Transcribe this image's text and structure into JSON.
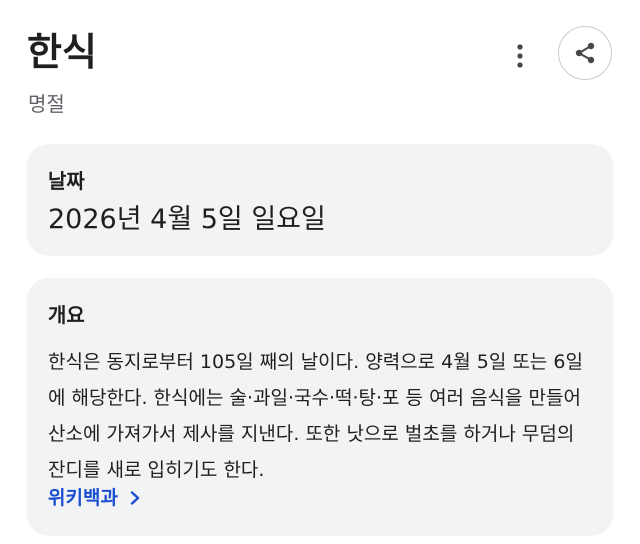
{
  "header": {
    "title": "한식",
    "subtitle": "명절",
    "more_icon": "more-vert-icon",
    "share_icon": "share-icon"
  },
  "date_card": {
    "label": "날짜",
    "value": "2026년 4월 5일 일요일"
  },
  "overview_card": {
    "label": "개요",
    "text": "한식은 동지로부터 105일 째의 날이다. 양력으로 4월 5일 또는 6일에 해당한다. 한식에는 술·과일·국수·떡·탕·포 등 여러 음식을 만들어 산소에 가져가서 제사를 지낸다. 또한 낫으로 벌초를 하거나 무덤의 잔디를 새로 입히기도 한다.",
    "source_label": "위키백과",
    "source_icon": "chevron-right-icon"
  },
  "colors": {
    "card_background": "#f1f3f4",
    "link": "#1a4ed1",
    "text": "#1f1f1f",
    "secondary_text": "#5f6368"
  }
}
